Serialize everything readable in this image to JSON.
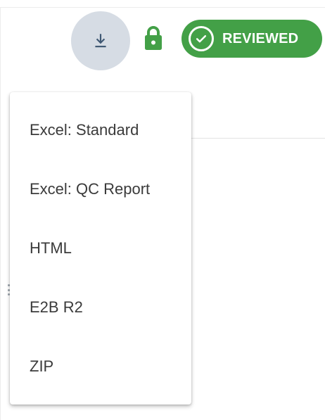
{
  "toolbar": {
    "download_icon": "download-icon",
    "lock_icon": "lock-icon",
    "status_badge": {
      "label": "REVIEWED",
      "icon": "check-circle-icon",
      "color": "#43a047"
    }
  },
  "export_menu": {
    "items": [
      {
        "label": "Excel: Standard"
      },
      {
        "label": "Excel: QC Report"
      },
      {
        "label": "HTML"
      },
      {
        "label": "E2B R2"
      },
      {
        "label": "ZIP"
      }
    ]
  },
  "colors": {
    "accent_green": "#43a047",
    "download_button_bg": "#d6dce4",
    "download_icon": "#3f5873",
    "menu_text": "#3b3b3b"
  }
}
